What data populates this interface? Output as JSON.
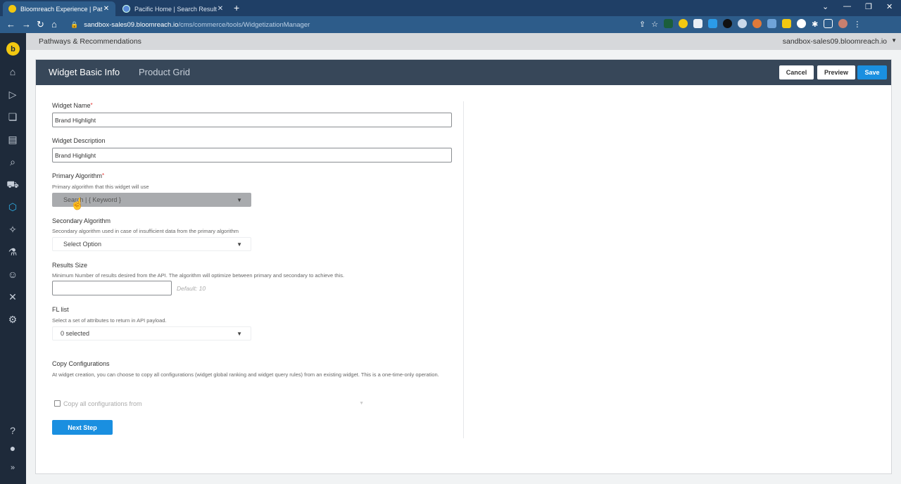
{
  "browser": {
    "tabs": [
      {
        "title": "Bloomreach Experience | Pathways",
        "active": true
      },
      {
        "title": "Pacific Home | Search Results",
        "active": false
      }
    ],
    "url_host": "sandbox-sales09.bloomreach.io",
    "url_path": "/cms/commerce/tools/WidgetizationManager",
    "window_controls": {
      "minimize": "—",
      "restore": "❐",
      "close": "✕",
      "chevron": "⌄"
    }
  },
  "app": {
    "brand_letter": "b",
    "section_title": "Pathways & Recommendations",
    "account": "sandbox-sales09.bloomreach.io"
  },
  "panel": {
    "tabs": [
      "Widget Basic Info",
      "Product Grid"
    ],
    "buttons": {
      "cancel": "Cancel",
      "preview": "Preview",
      "save": "Save"
    }
  },
  "form": {
    "widget_name": {
      "label": "Widget Name",
      "value": "Brand Highlight"
    },
    "widget_description": {
      "label": "Widget Description",
      "value": "Brand Highlight"
    },
    "primary_algorithm": {
      "label": "Primary Algorithm",
      "hint": "Primary algorithm that this widget will use",
      "value": "Search | { Keyword }"
    },
    "secondary_algorithm": {
      "label": "Secondary Algorithm",
      "hint": "Secondary algorithm used in case of insufficient data from the primary algorithm",
      "value": "Select Option"
    },
    "results_size": {
      "label": "Results Size",
      "hint": "Minimum Number of results desired from the API. The algorithm will optimize between primary and secondary to achieve this.",
      "value": "",
      "default_hint": "Default: 10"
    },
    "fl_list": {
      "label": "FL list",
      "hint": "Select a set of attributes to return in API payload.",
      "value": "0 selected"
    },
    "copy_configurations": {
      "label": "Copy Configurations",
      "hint": "At widget creation, you can choose to copy all configurations (widget global ranking and widget query rules) from an existing widget. This is a one-time-only operation.",
      "checkbox_label": "Copy all configurations from"
    },
    "next_button": "Next Step"
  },
  "colors": {
    "browser_tabbar": "#1f3f66",
    "browser_address": "#2d5c8a",
    "sidebar": "#1e2a3a",
    "panel_header": "#374759",
    "primary_button": "#1a8fe0",
    "required_marker": "#e53935",
    "brand_yellow": "#f2c811"
  }
}
